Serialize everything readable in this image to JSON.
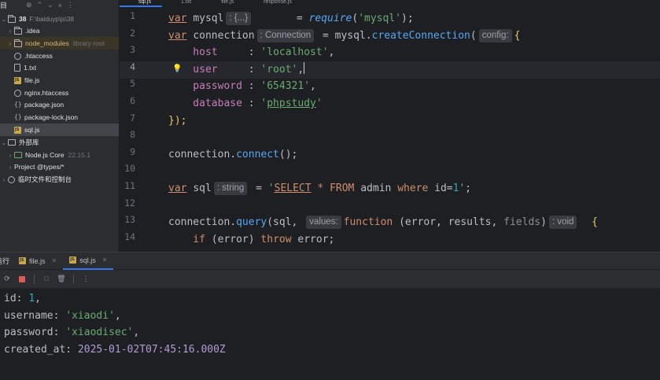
{
  "project": {
    "root": "38",
    "root_path": "F:\\baiduyp\\js\\38",
    "items": [
      {
        "label": "idea",
        "icon": "folder-icon",
        "collapsed": true
      },
      {
        "label": "node_modules",
        "sublabel": "library root",
        "icon": "folder-icon",
        "collapsed": true
      },
      {
        "label": ".htaccess",
        "icon": "config-file-icon"
      },
      {
        "label": "1.txt",
        "icon": "text-file-icon"
      },
      {
        "label": "file.js",
        "icon": "js-file-icon"
      },
      {
        "label": "nginx.htaccess",
        "icon": "config-file-icon"
      },
      {
        "label": "package.json",
        "icon": "json-file-icon"
      },
      {
        "label": "package-lock.json",
        "icon": "json-file-icon"
      },
      {
        "label": "sql.js",
        "icon": "js-file-icon",
        "selected": true
      },
      {
        "label": "外部库",
        "icon": "library-icon"
      },
      {
        "label": "Node.js Core",
        "sublabel": "22.15.1",
        "icon": "nodejs-icon"
      },
      {
        "label": "Project @types/*",
        "icon": "library-icon"
      },
      {
        "label": "临时文件和控制台",
        "icon": "scratch-icon"
      }
    ]
  },
  "editor": {
    "tabs": [
      "sql.js",
      "1.txt",
      "file.js",
      "response.js"
    ],
    "line_numbers": [
      "1",
      "2",
      "3",
      "4",
      "5",
      "6",
      "7",
      "8",
      "9",
      "10",
      "11",
      "12",
      "13",
      "14"
    ],
    "current_line": 4,
    "hints": {
      "mysql_type": ": {...}",
      "connection_type": ": Connection",
      "config_param": "config:",
      "sql_type": ": string",
      "values_param": "values:",
      "void_type": ": void"
    },
    "code": {
      "l1_var": "var",
      "l1_name": "mysql",
      "l1_eq": "       = ",
      "l1_require": "require",
      "l1_open": "(",
      "l1_arg": "'mysql'",
      "l1_close": ");",
      "l2_var": "var",
      "l2_name": "connection",
      "l2_eq": " = mysql.",
      "l2_fn": "createConnection",
      "l2_open": "(",
      "l2_brace": "{",
      "l3_key": "    host",
      "l3_sep": "     : ",
      "l3_val": "'localhost'",
      "l3_comma": ",",
      "l4_key": "    user",
      "l4_sep": "     : ",
      "l4_val": "'root'",
      "l4_comma": ",",
      "l5_key": "    password",
      "l5_sep": " : ",
      "l5_val": "'654321'",
      "l5_comma": ",",
      "l6_key": "    database",
      "l6_sep": " : ",
      "l6_q1": "'",
      "l6_val": "phpstudy",
      "l6_q2": "'",
      "l7": "});",
      "l9_obj": "connection.",
      "l9_fn": "connect",
      "l9_rest": "();",
      "l11_var": "var",
      "l11_name": "sql",
      "l11_eq": " = ",
      "l11_q1": "'",
      "l11_select": "SELECT",
      "l11_star": " * ",
      "l11_from": "FROM",
      "l11_table": " admin ",
      "l11_where": "where",
      "l11_cond": " id=",
      "l11_num": "1",
      "l11_q2": "'",
      "l11_end": ";",
      "l13_obj": "connection.",
      "l13_fn": "query",
      "l13_args": "(sql, ",
      "l13_function": "function",
      "l13_params": " (error, results, ",
      "l13_fields": "fields",
      "l13_close": ")",
      "l13_brace": "  {",
      "l14_if": "    if",
      "l14_mid": " (error) ",
      "l14_throw": "throw",
      "l14_rest": " error;"
    }
  },
  "run": {
    "title": "运行",
    "tabs": [
      "file.js",
      "sql.js"
    ],
    "active_tab": "sql.js",
    "output": {
      "id_key": "id: ",
      "id_val": "1",
      "id_end": ",",
      "user_key": "username: ",
      "user_val": "'xiaodi'",
      "user_end": ",",
      "pass_key": "password: ",
      "pass_val": "'xiaodisec'",
      "pass_end": ",",
      "created_key": "created_at: ",
      "created_val": "2025-01-02T07:45:16.000Z"
    }
  },
  "colors": {
    "accent": "#3574f0",
    "keyword": "#cf8e6d",
    "string": "#6aab73",
    "function": "#56a8f5",
    "property": "#c77dbb",
    "number": "#2aacb8"
  }
}
